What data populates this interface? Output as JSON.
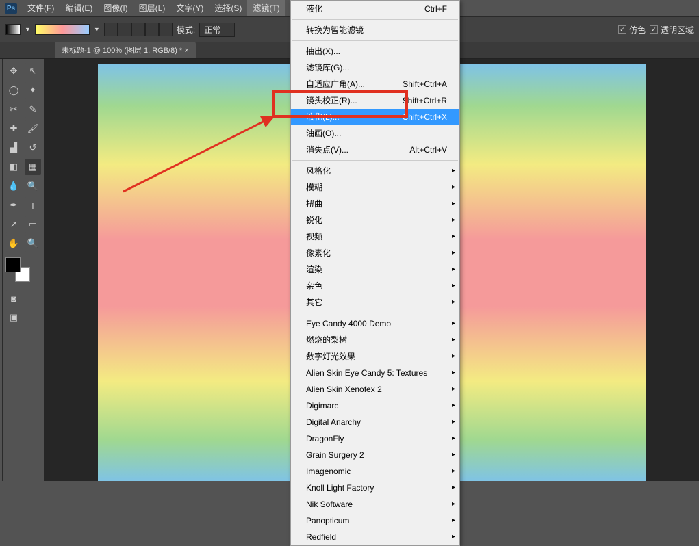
{
  "menubar": {
    "items": [
      "文件(F)",
      "编辑(E)",
      "图像(I)",
      "图层(L)",
      "文字(Y)",
      "选择(S)",
      "滤镜(T)"
    ]
  },
  "optbar": {
    "mode_label": "模式:",
    "mode_value": "正常",
    "opt2": "仿色",
    "opt3": "透明区域"
  },
  "doctab": "未标题-1 @ 100% (图层 1, RGB/8) * ×",
  "dropdown": [
    {
      "t": "item",
      "label": "液化",
      "shortcut": "Ctrl+F"
    },
    {
      "t": "sep"
    },
    {
      "t": "item",
      "label": "转换为智能滤镜"
    },
    {
      "t": "sep"
    },
    {
      "t": "item",
      "label": "抽出(X)..."
    },
    {
      "t": "item",
      "label": "滤镜库(G)..."
    },
    {
      "t": "item",
      "label": "自适应广角(A)...",
      "shortcut": "Shift+Ctrl+A"
    },
    {
      "t": "item",
      "label": "镜头校正(R)...",
      "shortcut": "Shift+Ctrl+R"
    },
    {
      "t": "item",
      "label": "液化(L)...",
      "shortcut": "Shift+Ctrl+X",
      "hi": true
    },
    {
      "t": "item",
      "label": "油画(O)..."
    },
    {
      "t": "item",
      "label": "消失点(V)...",
      "shortcut": "Alt+Ctrl+V"
    },
    {
      "t": "sep"
    },
    {
      "t": "item",
      "label": "风格化",
      "sub": true
    },
    {
      "t": "item",
      "label": "模糊",
      "sub": true
    },
    {
      "t": "item",
      "label": "扭曲",
      "sub": true
    },
    {
      "t": "item",
      "label": "锐化",
      "sub": true
    },
    {
      "t": "item",
      "label": "视频",
      "sub": true
    },
    {
      "t": "item",
      "label": "像素化",
      "sub": true
    },
    {
      "t": "item",
      "label": "渲染",
      "sub": true
    },
    {
      "t": "item",
      "label": "杂色",
      "sub": true
    },
    {
      "t": "item",
      "label": "其它",
      "sub": true
    },
    {
      "t": "sep"
    },
    {
      "t": "item",
      "label": "Eye Candy 4000 Demo",
      "sub": true
    },
    {
      "t": "item",
      "label": "燃烧的梨树",
      "sub": true
    },
    {
      "t": "item",
      "label": "数字灯光效果",
      "sub": true
    },
    {
      "t": "item",
      "label": "Alien Skin Eye Candy 5: Textures",
      "sub": true
    },
    {
      "t": "item",
      "label": "Alien Skin Xenofex 2",
      "sub": true
    },
    {
      "t": "item",
      "label": "Digimarc",
      "sub": true
    },
    {
      "t": "item",
      "label": "Digital Anarchy",
      "sub": true
    },
    {
      "t": "item",
      "label": "DragonFly",
      "sub": true
    },
    {
      "t": "item",
      "label": "Grain Surgery 2",
      "sub": true
    },
    {
      "t": "item",
      "label": "Imagenomic",
      "sub": true
    },
    {
      "t": "item",
      "label": "Knoll Light Factory",
      "sub": true
    },
    {
      "t": "item",
      "label": "Nik Software",
      "sub": true
    },
    {
      "t": "item",
      "label": "Panopticum",
      "sub": true
    },
    {
      "t": "item",
      "label": "Redfield",
      "sub": true
    }
  ],
  "ps": "Ps"
}
